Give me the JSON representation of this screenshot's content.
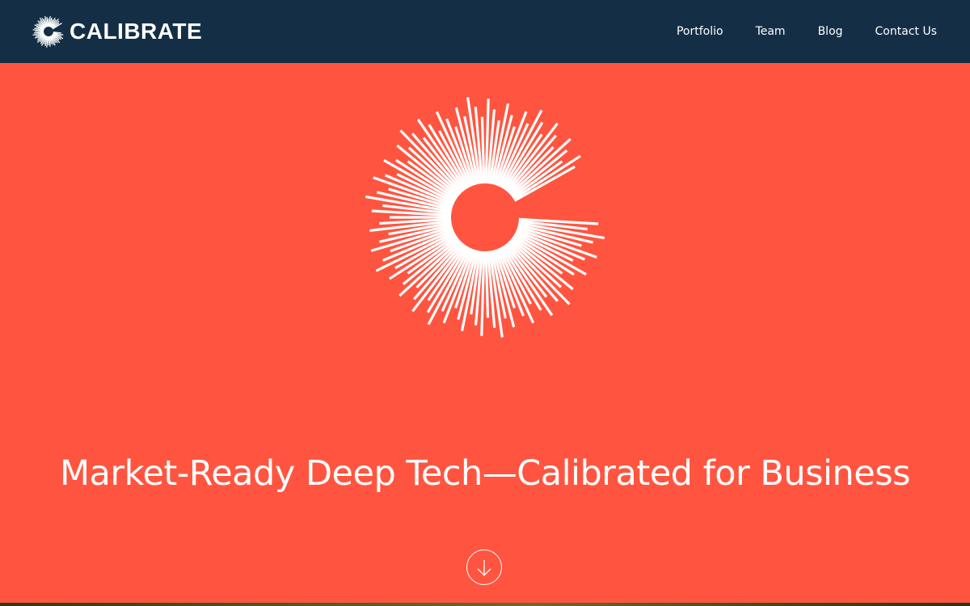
{
  "brand": {
    "name": "CALIBRATE",
    "logo_icon": "calibrate-burst-c-icon"
  },
  "nav": {
    "items": [
      {
        "label": "Portfolio"
      },
      {
        "label": "Team"
      },
      {
        "label": "Blog"
      },
      {
        "label": "Contact Us"
      }
    ]
  },
  "hero": {
    "title": "Market-Ready Deep Tech—Calibrated for Business",
    "mark_icon": "calibrate-burst-c-icon",
    "scroll_icon": "arrow-down-circle-icon"
  },
  "colors": {
    "header_bg": "#142f45",
    "hero_bg": "#ff5540",
    "text": "#ffffff"
  }
}
